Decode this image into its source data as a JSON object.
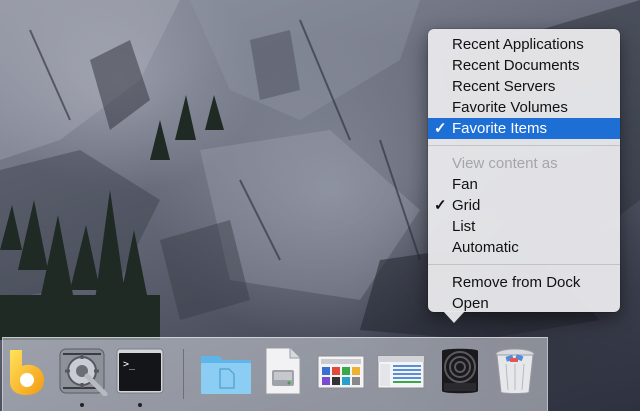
{
  "context_menu": {
    "section_1": [
      {
        "label": "Recent Applications",
        "checked": false,
        "highlighted": false
      },
      {
        "label": "Recent Documents",
        "checked": false,
        "highlighted": false
      },
      {
        "label": "Recent Servers",
        "checked": false,
        "highlighted": false
      },
      {
        "label": "Favorite Volumes",
        "checked": false,
        "highlighted": false
      },
      {
        "label": "Favorite Items",
        "checked": true,
        "highlighted": true
      }
    ],
    "view_header": "View content as",
    "section_2": [
      {
        "label": "Fan",
        "checked": false
      },
      {
        "label": "Grid",
        "checked": true
      },
      {
        "label": "List",
        "checked": false
      },
      {
        "label": "Automatic",
        "checked": false
      }
    ],
    "section_3": [
      {
        "label": "Remove from Dock"
      },
      {
        "label": "Open"
      }
    ],
    "check_glyph": "✓",
    "highlight_color": "#1d6fd6"
  },
  "dock": {
    "apps": [
      {
        "icon": "bluetooth-style-b-app-icon",
        "running": false
      },
      {
        "icon": "system-preferences-icon",
        "running": true
      },
      {
        "icon": "terminal-icon",
        "running": true,
        "prompt": ">_"
      }
    ],
    "stacks": [
      {
        "icon": "documents-folder-icon"
      },
      {
        "icon": "disk-utility-icon"
      },
      {
        "icon": "screenshot-stack-icon"
      },
      {
        "icon": "finder-window-stack-icon"
      },
      {
        "icon": "recent-items-stack-icon"
      },
      {
        "icon": "trash-icon"
      }
    ]
  }
}
